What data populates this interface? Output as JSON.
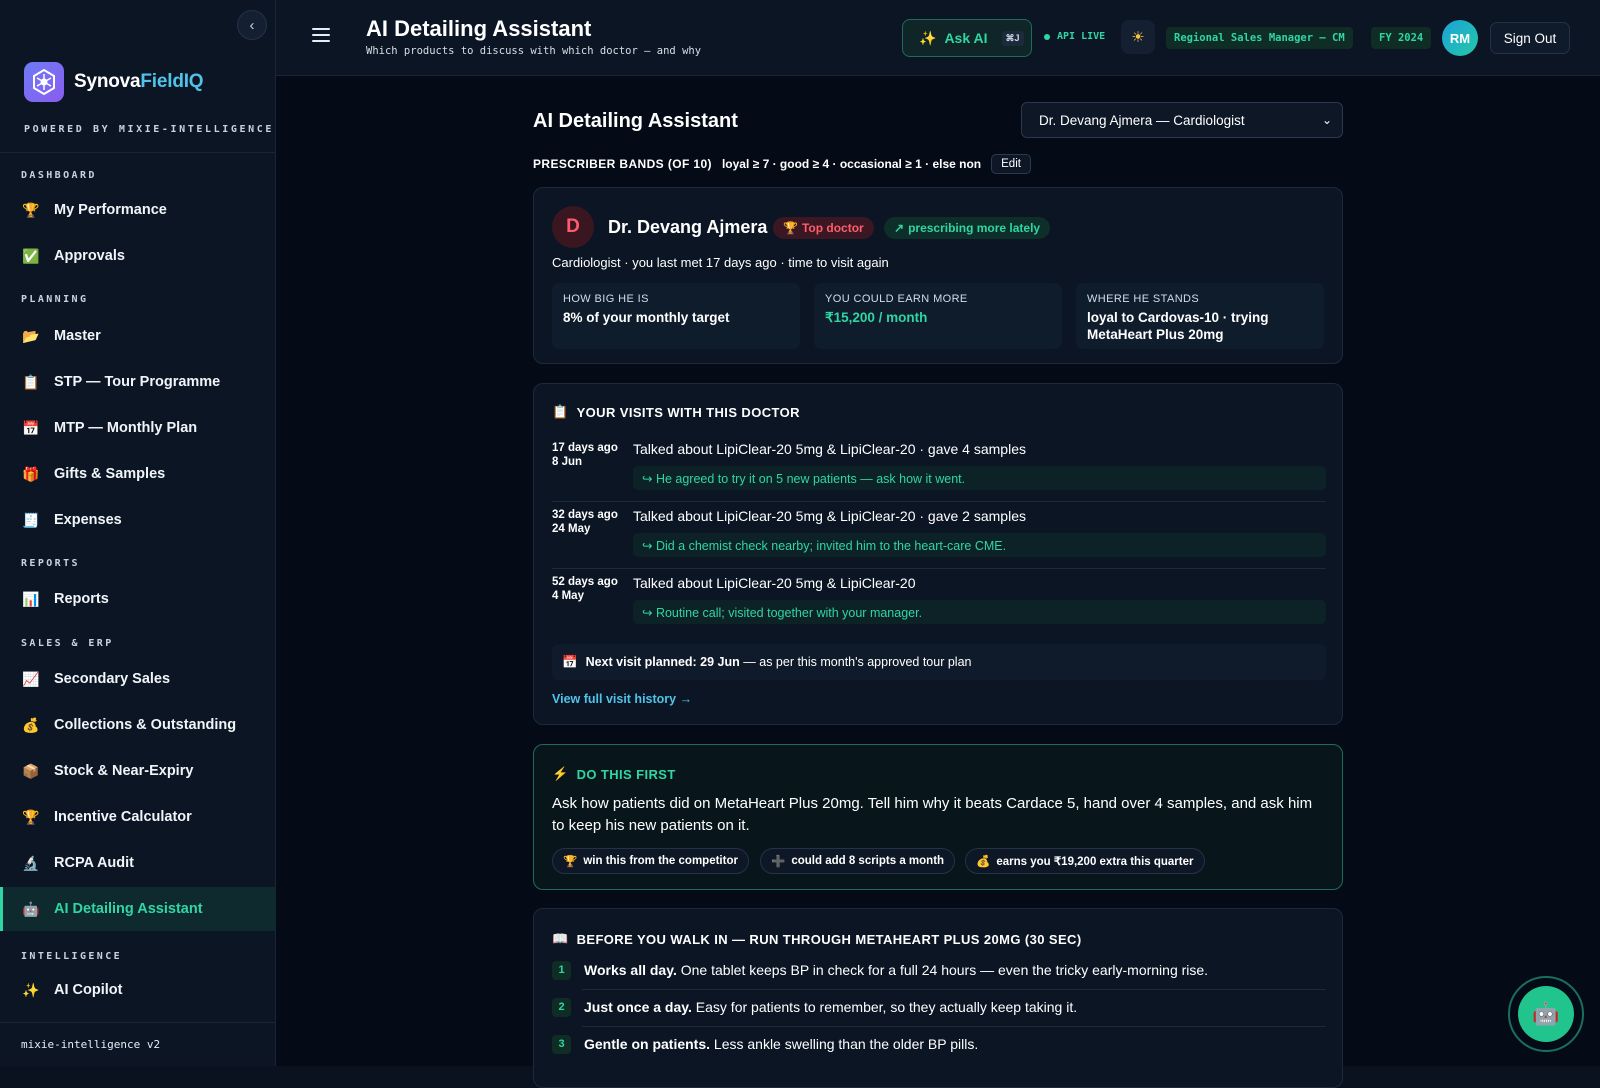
{
  "sidebar": {
    "collapse_icon": "‹",
    "brand_prefix": "Synova",
    "brand_suffix": "FieldIQ",
    "powered_by": "POWERED BY MIXIE-INTELLIGENCE",
    "sections": {
      "dashboard": "DASHBOARD",
      "planning": "PLANNING",
      "reports": "REPORTS",
      "sales": "SALES & ERP",
      "intelligence": "INTELLIGENCE"
    },
    "items": [
      {
        "label": "My Performance",
        "icon": "🏆"
      },
      {
        "label": "Approvals",
        "icon": "✅"
      },
      {
        "label": "Master",
        "icon": "📂"
      },
      {
        "label": "STP — Tour Programme",
        "icon": "📋"
      },
      {
        "label": "MTP — Monthly Plan",
        "icon": "📅"
      },
      {
        "label": "Gifts & Samples",
        "icon": "🎁"
      },
      {
        "label": "Expenses",
        "icon": "🧾"
      },
      {
        "label": "Reports",
        "icon": "📊"
      },
      {
        "label": "Secondary Sales",
        "icon": "📈"
      },
      {
        "label": "Collections & Outstanding",
        "icon": "💰"
      },
      {
        "label": "Stock & Near-Expiry",
        "icon": "📦"
      },
      {
        "label": "Incentive Calculator",
        "icon": "🏆"
      },
      {
        "label": "RCPA Audit",
        "icon": "🔬"
      },
      {
        "label": "AI Detailing Assistant",
        "icon": "🤖"
      },
      {
        "label": "AI Copilot",
        "icon": "✨"
      }
    ],
    "footer": "mixie-intelligence v2"
  },
  "topbar": {
    "title": "AI Detailing Assistant",
    "subtitle": "Which products to discuss with which doctor — and why",
    "ask_ai": "Ask AI",
    "ask_ai_icon": "✨",
    "shortcut": "⌘J",
    "api_status": "API LIVE",
    "theme_icon": "☀",
    "role": "Regional Sales Manager — CM",
    "fy": "FY 2024",
    "avatar_initials": "RM",
    "sign_out": "Sign Out"
  },
  "page": {
    "heading": "AI Detailing Assistant",
    "selected_doctor": "Dr. Devang Ajmera — Cardiologist",
    "bands_label": "PRESCRIBER BANDS (OF 10)",
    "bands_rules": "loyal ≥ 7 · good ≥ 4 · occasional ≥ 1 · else non",
    "edit": "Edit"
  },
  "doctor": {
    "initial": "D",
    "name": "Dr. Devang Ajmera",
    "badge_top": "Top doctor",
    "badge_top_icon": "🏆",
    "badge_trend": "prescribing more lately",
    "badge_trend_icon": "↗",
    "meta": "Cardiologist · you last met 17 days ago · time to visit again",
    "stats": [
      {
        "key": "HOW BIG HE IS",
        "value": "8% of your monthly target"
      },
      {
        "key": "YOU COULD EARN MORE",
        "value": "₹15,200 / month"
      },
      {
        "key": "WHERE HE STANDS",
        "value": "loyal to Cardovas-10 · trying MetaHeart Plus 20mg"
      }
    ]
  },
  "visits": {
    "heading": "YOUR VISITS WITH THIS DOCTOR",
    "heading_icon": "📋",
    "items": [
      {
        "ago": "17 days ago",
        "date": "8 Jun",
        "what": "Talked about LipiClear-20 5mg & LipiClear-20 · gave 4 samples",
        "note": "↪ He agreed to try it on 5 new patients — ask how it went."
      },
      {
        "ago": "32 days ago",
        "date": "24 May",
        "what": "Talked about LipiClear-20 5mg & LipiClear-20 · gave 2 samples",
        "note": "↪ Did a chemist check nearby; invited him to the heart-care CME."
      },
      {
        "ago": "52 days ago",
        "date": "4 May",
        "what": "Talked about LipiClear-20 5mg & LipiClear-20",
        "note": "↪ Routine call; visited together with your manager."
      }
    ],
    "next_icon": "📅",
    "next_bold": "Next visit planned: 29 Jun",
    "next_rest": " — as per this month's approved tour plan",
    "history_link": "View full visit history →"
  },
  "do_first": {
    "heading": "DO THIS FIRST",
    "heading_icon": "⚡",
    "text": "Ask how patients did on MetaHeart Plus 20mg. Tell him why it beats Cardace 5, hand over 4 samples, and ask him to keep his new patients on it.",
    "chips": [
      {
        "icon": "🏆",
        "label": "win this from the competitor"
      },
      {
        "icon": "➕",
        "label": "could add 8 scripts a month"
      },
      {
        "icon": "💰",
        "label": "earns you ₹19,200 extra this quarter"
      }
    ]
  },
  "walk_in": {
    "heading": "BEFORE YOU WALK IN — RUN THROUGH METAHEART PLUS 20MG (30 SEC)",
    "heading_icon": "📖",
    "steps": [
      {
        "n": "1",
        "bold": "Works all day.",
        "rest": " One tablet keeps BP in check for a full 24 hours — even the tricky early-morning rise."
      },
      {
        "n": "2",
        "bold": "Just once a day.",
        "rest": " Easy for patients to remember, so they actually keep taking it."
      },
      {
        "n": "3",
        "bold": "Gentle on patients.",
        "rest": " Less ankle swelling than the older BP pills."
      }
    ]
  },
  "fab_icon": "🤖"
}
